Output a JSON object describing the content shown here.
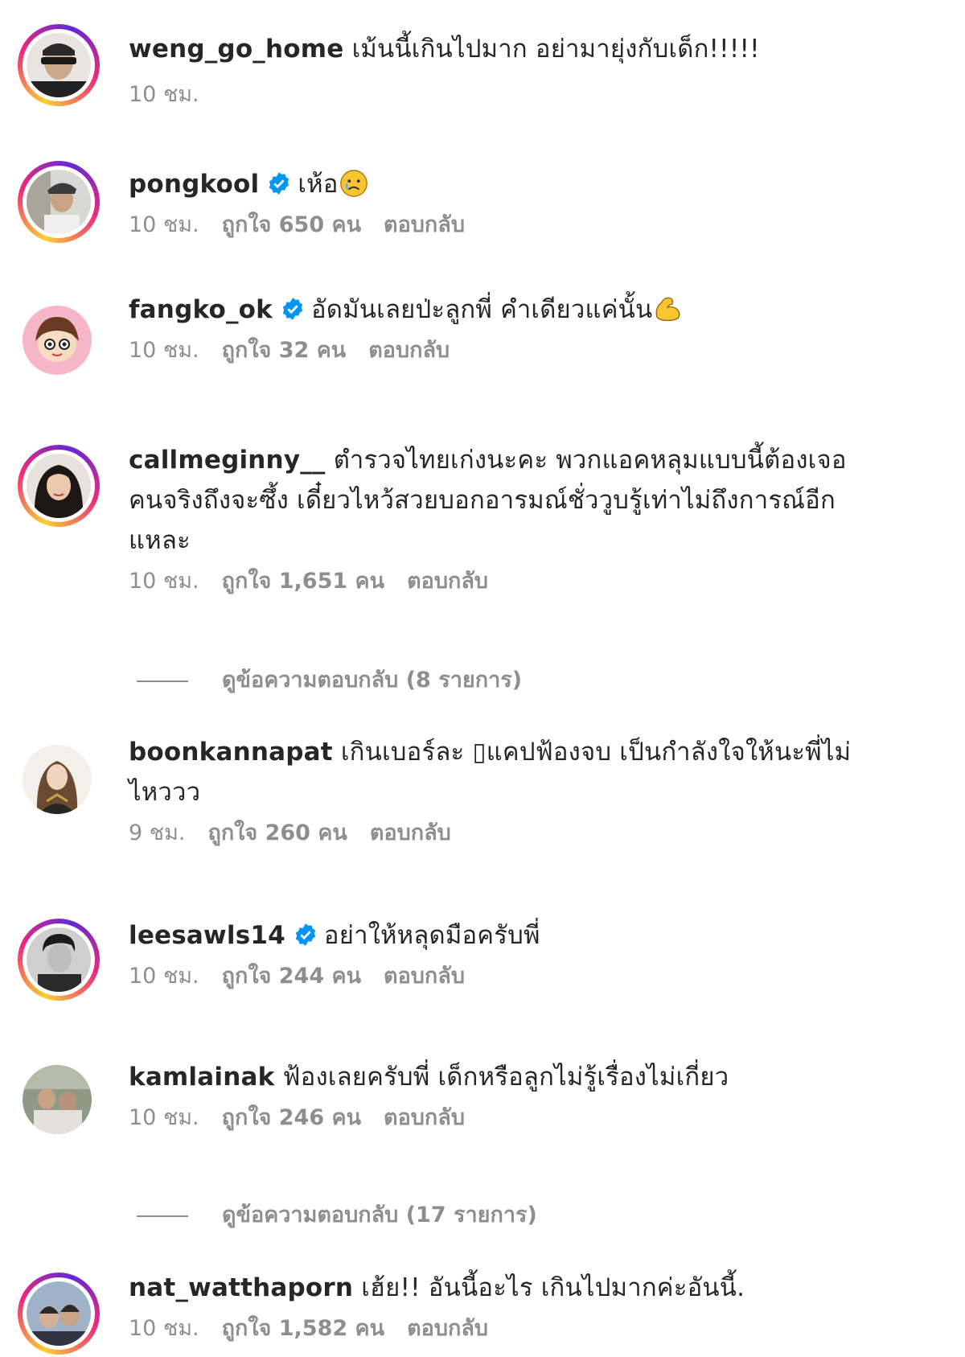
{
  "comments": [
    {
      "username": "weng_go_home",
      "verified": false,
      "lines": [
        "เม้นนี้เกินไปมาก อย่ามายุ่งกับเด็ก!!!!!"
      ],
      "time": "10 ชม.",
      "likes": "",
      "reply": ""
    },
    {
      "username": "pongkool",
      "verified": true,
      "lines": [
        "เห้อ"
      ],
      "emoji": "sad-face-emoji",
      "time": "10 ชม.",
      "likes": "ถูกใจ 650 คน",
      "reply": "ตอบกลับ"
    },
    {
      "username": "fangko_ok",
      "verified": true,
      "lines": [
        "อัดมันเลยป่ะลูกพี่ คำเดียวแค่นั้น"
      ],
      "emoji": "flexed-biceps-emoji",
      "time": "10 ชม.",
      "likes": "ถูกใจ 32 คน",
      "reply": "ตอบกลับ"
    },
    {
      "username": "callmeginny__",
      "verified": false,
      "lines": [
        "ตำรวจไทยเก่งนะคะ พวกแอคหลุมแบบนี้ต้องเจอ",
        "คนจริงถึงจะซึ้ง เดี๋ยวไหว้สวยบอกอารมณ์ชั่ววูบรู้เท่าไม่ถึงการณ์อีก",
        "แหละ"
      ],
      "time": "10 ชม.",
      "likes": "ถูกใจ 1,651 คน",
      "reply": "ตอบกลับ"
    },
    {
      "username": "boonkannapat",
      "verified": false,
      "lines": [
        "เกินเบอร์ละ ▯แคปฟ้องจบ เป็นกำลังใจให้นะพี่ไม่",
        "ไหววว"
      ],
      "time": "9 ชม.",
      "likes": "ถูกใจ 260 คน",
      "reply": "ตอบกลับ"
    },
    {
      "username": "leesawls14",
      "verified": true,
      "lines": [
        "อย่าให้หลุดมือครับพี่"
      ],
      "time": "10 ชม.",
      "likes": "ถูกใจ 244 คน",
      "reply": "ตอบกลับ"
    },
    {
      "username": "kamlainak",
      "verified": false,
      "lines": [
        "ฟ้องเลยครับพี่ เด็กหรือลูกไม่รู้เรื่องไม่เกี่ยว"
      ],
      "time": "10 ชม.",
      "likes": "ถูกใจ 246 คน",
      "reply": "ตอบกลับ"
    },
    {
      "username": "nat_watthaporn",
      "verified": false,
      "lines": [
        "เฮ้ย!! อันนี้อะไร เกินไปมากค่ะอันนี้."
      ],
      "time": "10 ชม.",
      "likes": "ถูกใจ 1,582 คน",
      "reply": "ตอบกลับ"
    }
  ],
  "view_replies": [
    {
      "label": "ดูข้อความตอบกลับ (8 รายการ)"
    },
    {
      "label": "ดูข้อความตอบกลับ (17 รายการ)"
    }
  ],
  "colors": {
    "text": "#262626",
    "secondary": "#8e8e8e",
    "verified_blue": "#0095f6"
  }
}
